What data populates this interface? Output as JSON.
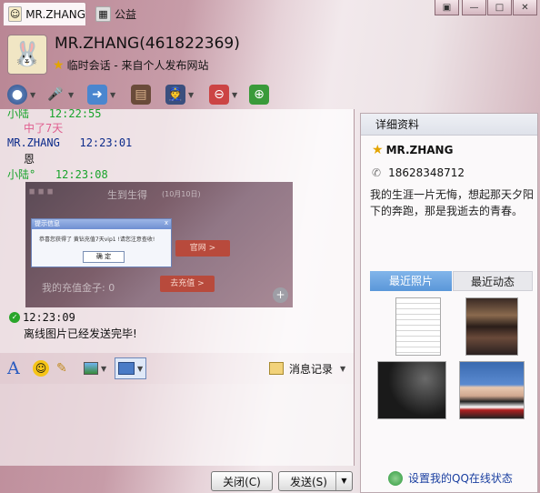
{
  "tabs": [
    {
      "label": "MR.ZHANG",
      "icon": "avatar-icon"
    },
    {
      "label": "公益",
      "icon": "charity-icon"
    }
  ],
  "header": {
    "name": "MR.ZHANG(461822369)",
    "session": "临时会话 - 来自个人发布网站"
  },
  "messages": [
    {
      "sender": "小陆",
      "time": "12:22:55",
      "text": "中了7天"
    },
    {
      "sender": "MR.ZHANG",
      "time": "12:23:01",
      "text": "恩"
    },
    {
      "sender": "小陆°",
      "time": "12:23:08"
    }
  ],
  "image_message": {
    "dialog_title": "提示信息",
    "dialog_close": "x",
    "dialog_message": "恭喜您获得了 黄钻充值7天vip1 !请您注意查收!",
    "dialog_button": "确 定",
    "banner_right": "官网 >",
    "recharge_button": "去充值 >",
    "gold_text": "我的充值金子: 0",
    "partial_text_1": "生到生得",
    "partial_text_2": "(10月10日)"
  },
  "system_message": {
    "time": "12:23:09",
    "text": "离线图片已经发送完毕!"
  },
  "format_bar": {
    "history_label": "消息记录"
  },
  "buttons": {
    "close": "关闭(C)",
    "send": "发送(S)"
  },
  "side": {
    "header": "详细资料",
    "name": "MR.ZHANG",
    "phone": "18628348712",
    "signature": "我的生涯一片无悔，想起那天夕阳下的奔跑，那是我逝去的青春。",
    "tab_photos": "最近照片",
    "tab_activity": "最近动态",
    "status_link": "设置我的QQ在线状态"
  },
  "colors": {
    "accent_blue": "#5a97d9",
    "sender_green": "#17a32a",
    "sender_navy": "#0b2a8a",
    "pink_text": "#e06090"
  }
}
